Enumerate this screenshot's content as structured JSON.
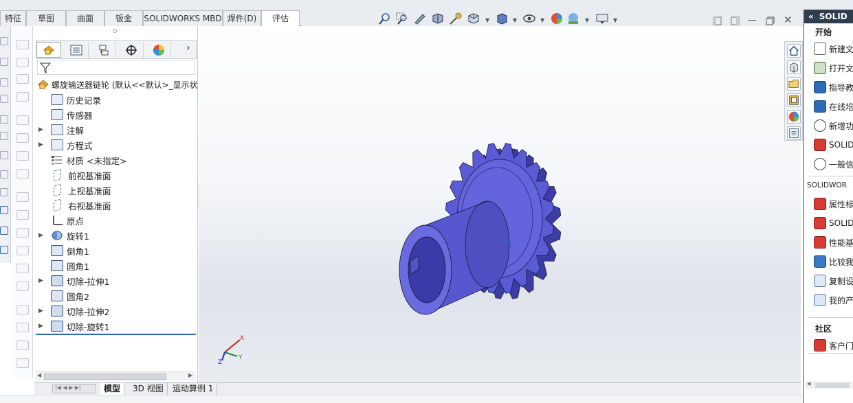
{
  "command_tabs": [
    {
      "label": "特征",
      "active": false
    },
    {
      "label": "草图",
      "active": false
    },
    {
      "label": "曲面",
      "active": false
    },
    {
      "label": "钣金",
      "active": false
    },
    {
      "label": "SOLIDWORKS MBD",
      "active": false
    },
    {
      "label": "焊件(D)",
      "active": false
    },
    {
      "label": "评估",
      "active": true
    }
  ],
  "view_toolbar": {
    "icons": [
      "zoom-to-fit-icon",
      "zoom-to-area-icon",
      "previous-view-icon",
      "section-view-icon",
      "dynamic-annotation-icon",
      "view-orientation-icon",
      "display-style-icon",
      "hide-show-items-icon",
      "edit-appearance-icon",
      "apply-scene-icon",
      "view-settings-icon"
    ]
  },
  "feature_manager": {
    "tabs": [
      "feature-manager-icon",
      "property-manager-icon",
      "configuration-manager-icon",
      "dimxpert-icon",
      "display-manager-icon"
    ],
    "root_label": "螺旋输送器链轮 (默认<<默认>_显示状",
    "items": [
      {
        "label": "历史记录",
        "icon": "history-icon",
        "expandable": false
      },
      {
        "label": "传感器",
        "icon": "sensor-icon",
        "expandable": false
      },
      {
        "label": "注解",
        "icon": "annotation-icon",
        "expandable": true
      },
      {
        "label": "方程式",
        "icon": "equation-icon",
        "expandable": true
      },
      {
        "label": "材质 <未指定>",
        "icon": "material-icon",
        "expandable": false
      },
      {
        "label": "前视基准面",
        "icon": "plane-icon",
        "expandable": false
      },
      {
        "label": "上视基准面",
        "icon": "plane-icon",
        "expandable": false
      },
      {
        "label": "右视基准面",
        "icon": "plane-icon",
        "expandable": false
      },
      {
        "label": "原点",
        "icon": "origin-icon",
        "expandable": false
      },
      {
        "label": "旋转1",
        "icon": "revolve-icon",
        "expandable": true
      },
      {
        "label": "倒角1",
        "icon": "chamfer-icon",
        "expandable": false
      },
      {
        "label": "圆角1",
        "icon": "fillet-icon",
        "expandable": false
      },
      {
        "label": "切除-拉伸1",
        "icon": "cut-extrude-icon",
        "expandable": true
      },
      {
        "label": "圆角2",
        "icon": "fillet-icon",
        "expandable": false
      },
      {
        "label": "切除-拉伸2",
        "icon": "cut-extrude-icon",
        "expandable": true
      },
      {
        "label": "切除-旋转1",
        "icon": "cut-revolve-icon",
        "expandable": true
      }
    ]
  },
  "bottom_tabs": [
    {
      "label": "模型",
      "active": true
    },
    {
      "label": "3D 视图",
      "active": false
    },
    {
      "label": "运动算例 1",
      "active": false
    }
  ],
  "triad": {
    "x": "X",
    "y": "Y",
    "z": "Z"
  },
  "task_pane": {
    "header": "SOLID",
    "collapse_glyph": "«",
    "sections": [
      {
        "title": "开始",
        "items": [
          {
            "label": "新建文",
            "icon": "new-document-icon"
          },
          {
            "label": "打开文",
            "icon": "open-document-icon"
          },
          {
            "label": "指导教",
            "icon": "tutorial-icon"
          },
          {
            "label": "在线培",
            "icon": "online-training-icon"
          },
          {
            "label": "新增功",
            "icon": "whats-new-icon"
          },
          {
            "label": "SOLIDW",
            "icon": "solidworks-icon"
          },
          {
            "label": "一般信",
            "icon": "info-icon"
          }
        ]
      },
      {
        "title": "SOLIDWOR",
        "items": [
          {
            "label": "属性标",
            "icon": "property-tab-icon"
          },
          {
            "label": "SOLIDW",
            "icon": "rx-icon"
          },
          {
            "label": "性能基",
            "icon": "benchmark-icon"
          },
          {
            "label": "比较我",
            "icon": "compare-icon"
          },
          {
            "label": "复制设",
            "icon": "copy-settings-icon"
          },
          {
            "label": "我的产",
            "icon": "my-products-icon"
          }
        ]
      },
      {
        "title": "社区",
        "items": [
          {
            "label": "客户门",
            "icon": "customer-portal-icon"
          }
        ]
      }
    ],
    "side_tabs": [
      "home-icon",
      "design-library-icon",
      "file-explorer-icon",
      "view-palette-icon",
      "appearances-icon",
      "custom-properties-icon"
    ]
  },
  "colors": {
    "part": "#5b5bd6",
    "part_shadow": "#3c3ca6",
    "highlight": "#2c6bb5"
  }
}
